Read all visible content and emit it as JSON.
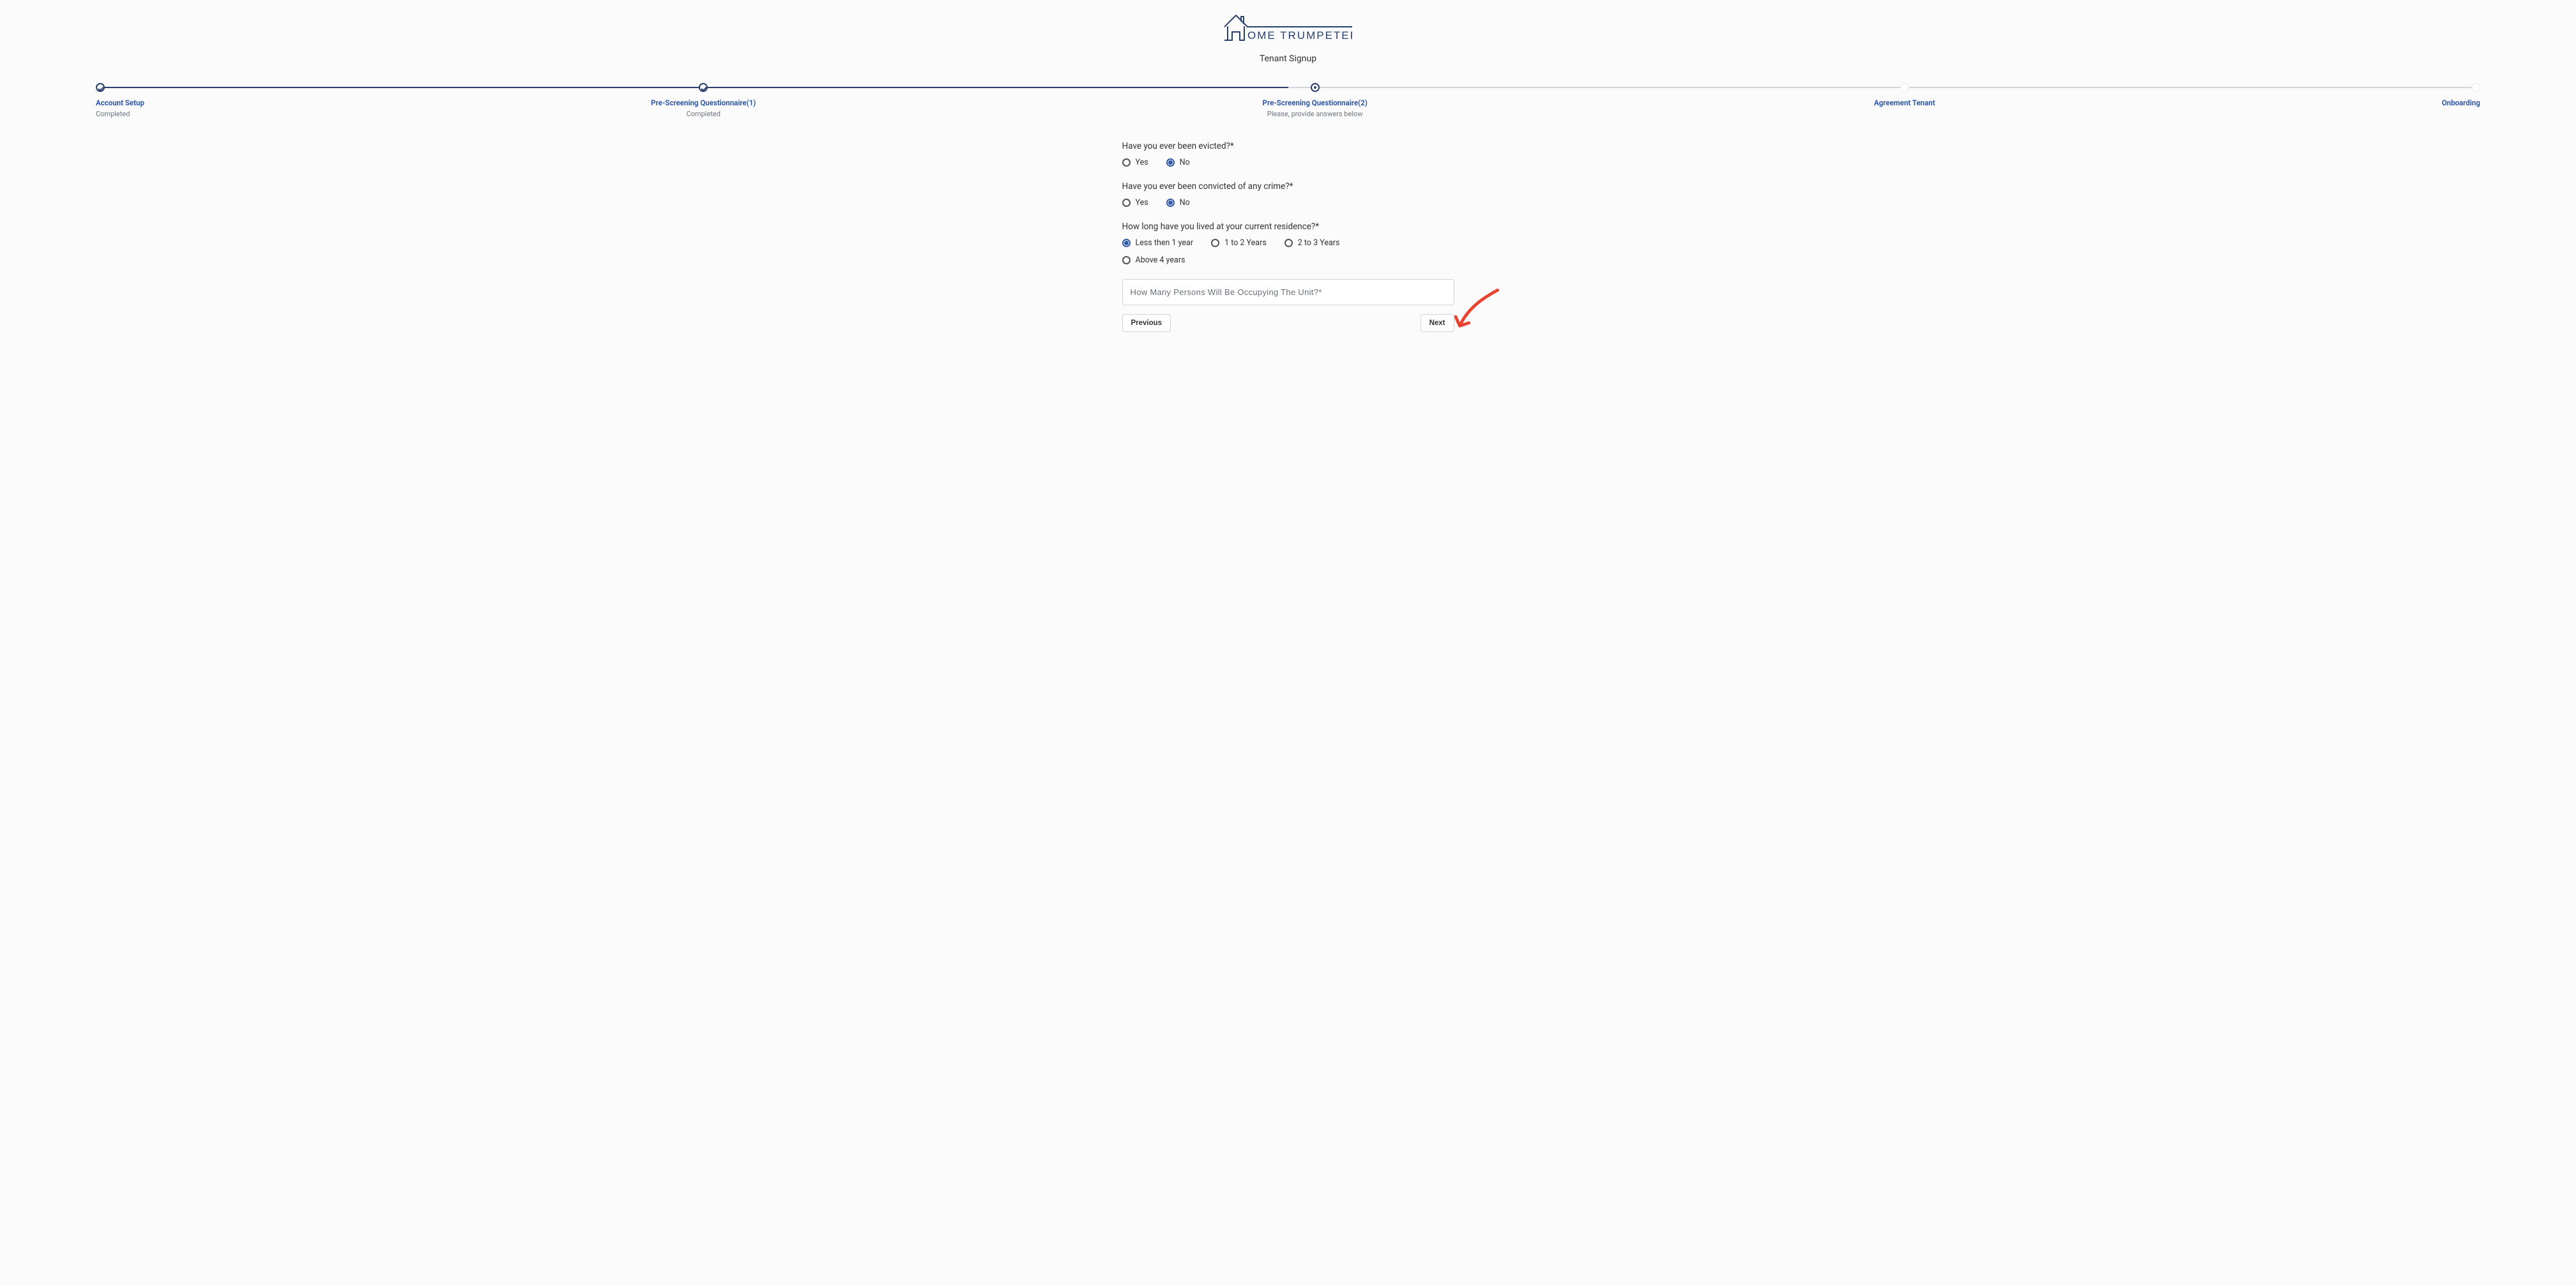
{
  "brand": {
    "name": "OME TRUMPETER"
  },
  "subtitle": "Tenant Signup",
  "colors": {
    "accent": "#293f6b",
    "link": "#2f59a7",
    "annotation": "#e8432e"
  },
  "stepper": {
    "steps": [
      {
        "title": "Account Setup",
        "sub": "Completed",
        "state": "done",
        "align": "left"
      },
      {
        "title": "Pre-Screening Questionnaire(1)",
        "sub": "Completed",
        "state": "done",
        "align": "center"
      },
      {
        "title": "Pre-Screening Questionnaire(2)",
        "sub": "Please, provide answers below",
        "state": "active",
        "align": "center"
      },
      {
        "title": "Agreement Tenant",
        "sub": "",
        "state": "future",
        "align": "center"
      },
      {
        "title": "Onboarding",
        "sub": "",
        "state": "future",
        "align": "right"
      }
    ]
  },
  "questions": {
    "q1": {
      "label": "Have you ever been evicted?*",
      "options": [
        {
          "label": "Yes",
          "selected": false
        },
        {
          "label": "No",
          "selected": true
        }
      ]
    },
    "q2": {
      "label": "Have you ever been convicted of any crime?*",
      "options": [
        {
          "label": "Yes",
          "selected": false
        },
        {
          "label": "No",
          "selected": true
        }
      ]
    },
    "q3": {
      "label": "How long have you lived at your current residence?*",
      "options": [
        {
          "label": "Less then 1 year",
          "selected": true
        },
        {
          "label": "1 to 2 Years",
          "selected": false
        },
        {
          "label": "2 to 3 Years",
          "selected": false
        },
        {
          "label": "Above 4 years",
          "selected": false
        }
      ]
    },
    "occupants": {
      "placeholder": "How Many Persons Will Be Occupying The Unit?*",
      "value": ""
    }
  },
  "buttons": {
    "prev": "Previous",
    "next": "Next"
  }
}
